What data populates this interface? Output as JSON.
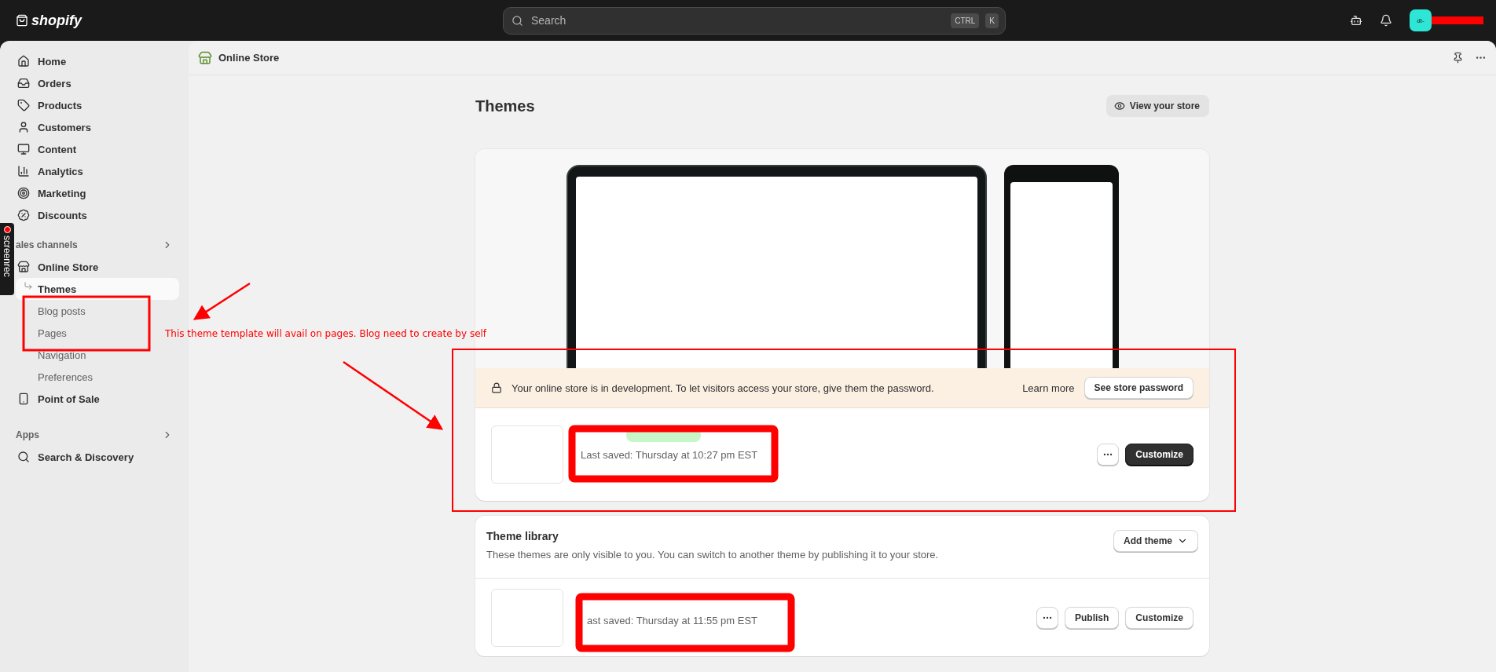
{
  "topbar": {
    "logo": "shopify",
    "search": {
      "placeholder": "Search",
      "keys": [
        "CTRL",
        "K"
      ]
    },
    "avatar": "dt-"
  },
  "sidebar": {
    "items": [
      {
        "label": "Home",
        "selected": false
      },
      {
        "label": "Orders",
        "selected": false
      },
      {
        "label": "Products",
        "selected": false
      },
      {
        "label": "Customers",
        "selected": false
      },
      {
        "label": "Content",
        "selected": false
      },
      {
        "label": "Analytics",
        "selected": false
      },
      {
        "label": "Marketing",
        "selected": false
      },
      {
        "label": "Discounts",
        "selected": false
      }
    ],
    "sections": [
      {
        "title": "ales channels",
        "items": [
          {
            "label": "Online Store",
            "selected": false,
            "children": [
              {
                "label": "Themes",
                "selected": true
              },
              {
                "label": "Blog posts",
                "selected": false
              },
              {
                "label": "Pages",
                "selected": false
              },
              {
                "label": "Navigation",
                "selected": false
              },
              {
                "label": "Preferences",
                "selected": false
              }
            ]
          },
          {
            "label": "Point of Sale",
            "selected": false
          }
        ]
      },
      {
        "title": "Apps",
        "items": [
          {
            "label": "Search & Discovery",
            "selected": false
          }
        ]
      }
    ]
  },
  "header": {
    "title": "Online Store"
  },
  "page": {
    "title": "Themes",
    "view_button": "View your store"
  },
  "banner": {
    "text": "Your online store is in development. To let visitors access your store, give them the password.",
    "link": "Learn more",
    "button": "See store password"
  },
  "current_theme": {
    "last_saved": "Last saved: Thursday at 10:27 pm EST",
    "buttons": [
      {
        "label": "Customize",
        "kind": "primary"
      }
    ]
  },
  "library": {
    "title": "Theme library",
    "description": "These themes are only visible to you. You can switch to another theme by publishing it to your store.",
    "add_button": "Add theme",
    "themes": [
      {
        "last_saved": "ast saved: Thursday at 11:55 pm EST",
        "buttons": [
          {
            "label": "Publish",
            "kind": "secondary"
          },
          {
            "label": "Customize",
            "kind": "secondary"
          }
        ]
      }
    ]
  },
  "annotation": {
    "note": "This theme template will avail on pages. Blog need to create by self"
  },
  "recorder": {
    "label": "screenrec"
  }
}
